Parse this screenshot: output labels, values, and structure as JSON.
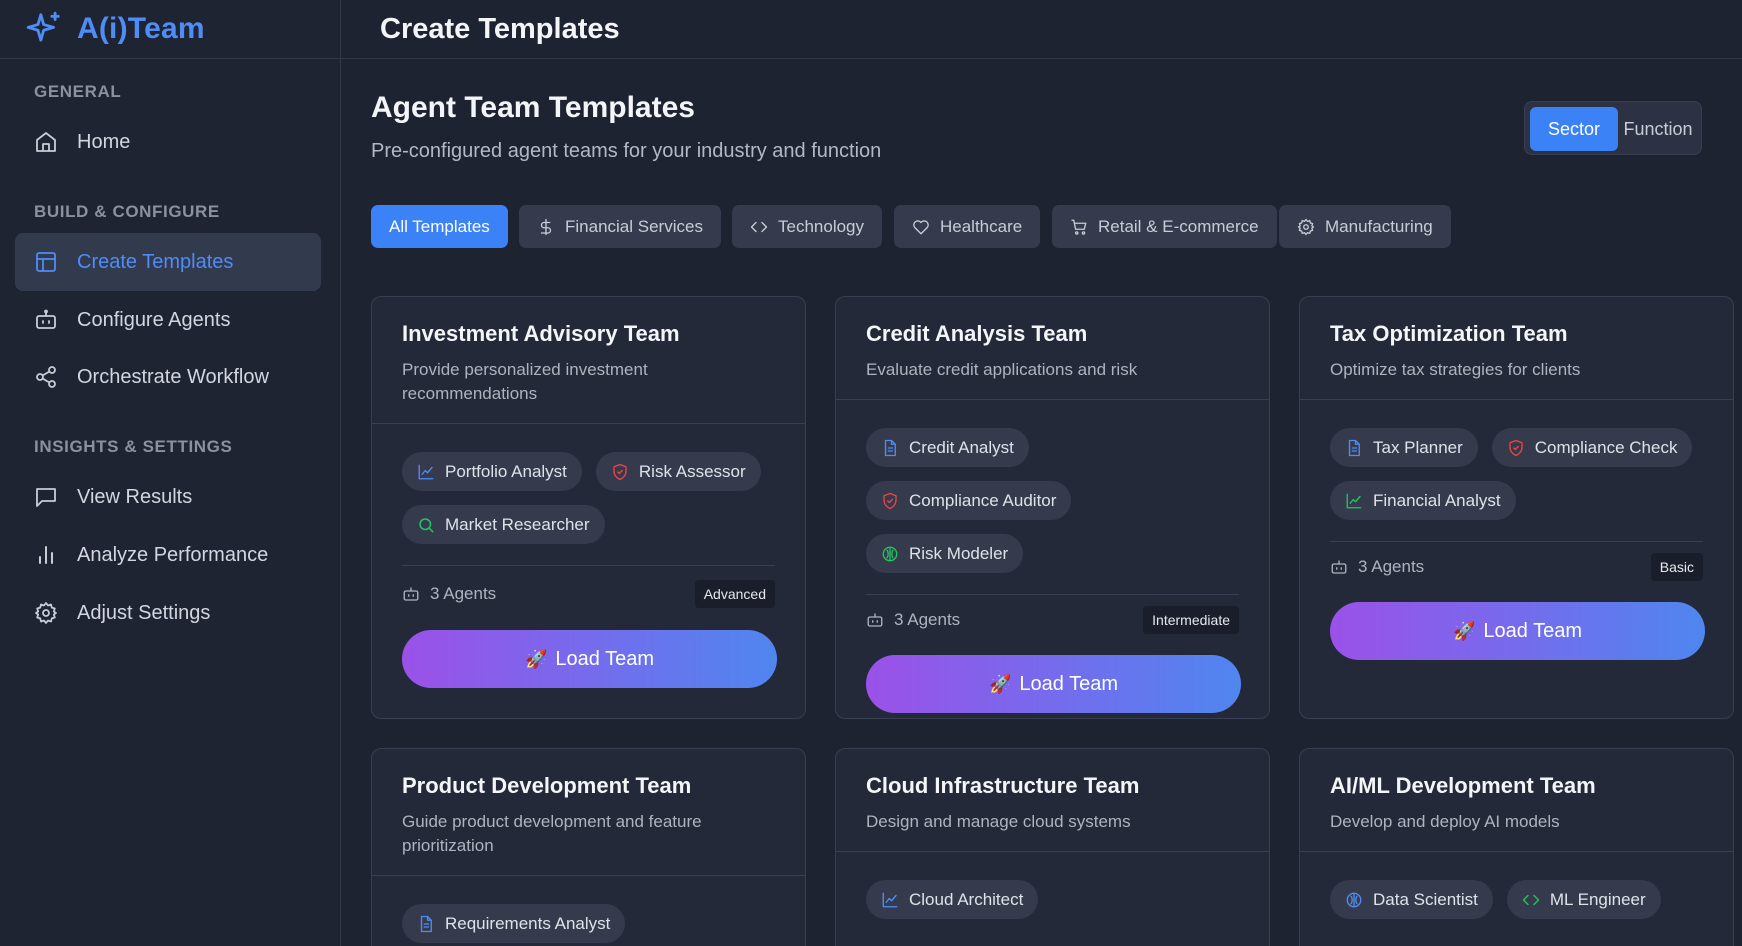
{
  "brand": {
    "name": "A(i)Team",
    "color": "#4f8cf6"
  },
  "sidebar": {
    "sections": [
      {
        "label": "GENERAL"
      },
      {
        "label": "BUILD & CONFIGURE"
      },
      {
        "label": "INSIGHTS & SETTINGS"
      }
    ],
    "items": [
      {
        "label": "Home",
        "icon": "home-icon",
        "active": false
      },
      {
        "label": "Create Templates",
        "icon": "layout-icon",
        "active": true
      },
      {
        "label": "Configure Agents",
        "icon": "bot-icon",
        "active": false
      },
      {
        "label": "Orchestrate Workflow",
        "icon": "share-icon",
        "active": false
      },
      {
        "label": "View Results",
        "icon": "message-icon",
        "active": false
      },
      {
        "label": "Analyze Performance",
        "icon": "bar-chart-icon",
        "active": false
      },
      {
        "label": "Adjust Settings",
        "icon": "gear-icon",
        "active": false
      }
    ]
  },
  "topbar": {
    "title": "Create Templates"
  },
  "main": {
    "title": "Agent Team Templates",
    "subtitle": "Pre-configured agent teams for your industry and function",
    "toggle": {
      "sector": "Sector",
      "function": "Function",
      "selected": "Sector"
    },
    "filters": [
      {
        "label": "All Templates",
        "icon": "",
        "active": true
      },
      {
        "label": "Financial Services",
        "icon": "dollar-icon",
        "active": false
      },
      {
        "label": "Technology",
        "icon": "code-icon",
        "active": false
      },
      {
        "label": "Healthcare",
        "icon": "heart-icon",
        "active": false
      },
      {
        "label": "Retail & E-commerce",
        "icon": "cart-icon",
        "active": false
      },
      {
        "label": "Manufacturing",
        "icon": "gear-icon",
        "active": false
      }
    ],
    "load_label": "Load Team",
    "cards": [
      {
        "title": "Investment Advisory Team",
        "description": "Provide personalized investment recommendations",
        "agents": [
          {
            "name": "Portfolio Analyst",
            "icon": "trend-icon"
          },
          {
            "name": "Risk Assessor",
            "icon": "shield-icon"
          },
          {
            "name": "Market Researcher",
            "icon": "search-icon"
          }
        ],
        "agents_count": "3 Agents",
        "level": "Advanced"
      },
      {
        "title": "Credit Analysis Team",
        "description": "Evaluate credit applications and risk",
        "agents": [
          {
            "name": "Credit Analyst",
            "icon": "document-icon"
          },
          {
            "name": "Compliance Auditor",
            "icon": "shield-icon"
          },
          {
            "name": "Risk Modeler",
            "icon": "brain-icon"
          }
        ],
        "agents_count": "3 Agents",
        "level": "Intermediate"
      },
      {
        "title": "Tax Optimization Team",
        "description": "Optimize tax strategies for clients",
        "agents": [
          {
            "name": "Tax Planner",
            "icon": "document-icon"
          },
          {
            "name": "Compliance Check",
            "icon": "shield-icon"
          },
          {
            "name": "Financial Analyst",
            "icon": "trend-icon"
          }
        ],
        "agents_count": "3 Agents",
        "level": "Basic"
      },
      {
        "title": "Product Development Team",
        "description": "Guide product development and feature prioritization",
        "agents": [
          {
            "name": "Requirements Analyst",
            "icon": "document-icon"
          }
        ]
      },
      {
        "title": "Cloud Infrastructure Team",
        "description": "Design and manage cloud systems",
        "agents": [
          {
            "name": "Cloud Architect",
            "icon": "trend-icon"
          }
        ]
      },
      {
        "title": "AI/ML Development Team",
        "description": "Develop and deploy AI models",
        "agents": [
          {
            "name": "Data Scientist",
            "icon": "brain-icon"
          },
          {
            "name": "ML Engineer",
            "icon": "code-icon"
          }
        ]
      }
    ]
  },
  "colors": {
    "background": "#1e2332",
    "accent": "#3b82f6",
    "button_gradient_start": "#9b51e8",
    "button_gradient_end": "#4f86f0",
    "icon_blue": "#4f8cf6",
    "icon_red": "#ef4444",
    "icon_green": "#22c55e"
  }
}
